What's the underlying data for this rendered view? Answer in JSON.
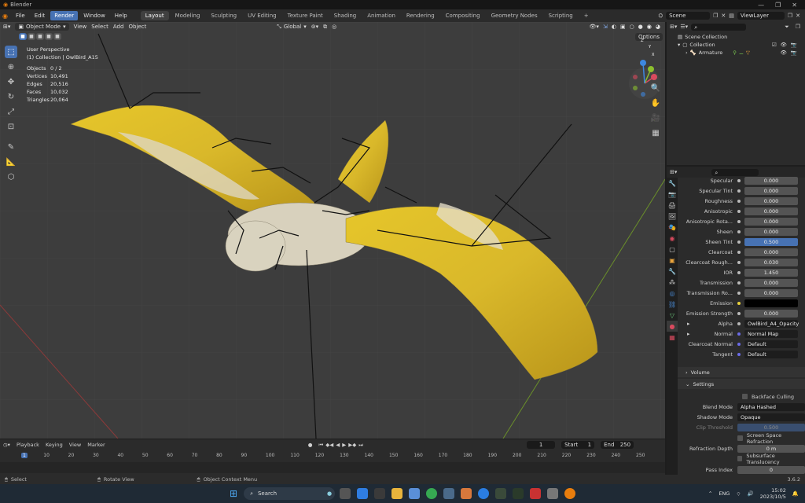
{
  "titlebar": {
    "title": "Blender"
  },
  "menus": [
    "File",
    "Edit",
    "Render",
    "Window",
    "Help"
  ],
  "workspaces": [
    "Layout",
    "Modeling",
    "Sculpting",
    "UV Editing",
    "Texture Paint",
    "Shading",
    "Animation",
    "Rendering",
    "Compositing",
    "Geometry Nodes",
    "Scripting"
  ],
  "scene": "Scene",
  "view_layer": "ViewLayer",
  "viewport_header": {
    "mode": "Object Mode",
    "items": [
      "View",
      "Select",
      "Add",
      "Object"
    ],
    "orientation": "Global",
    "options": "Options"
  },
  "overlay_text": {
    "perspective": "User Perspective",
    "collection": "(1) Collection | OwlBird_A15",
    "stats": [
      {
        "label": "Objects",
        "value": "0 / 2"
      },
      {
        "label": "Vertices",
        "value": "10,491"
      },
      {
        "label": "Edges",
        "value": "20,516"
      },
      {
        "label": "Faces",
        "value": "10,032"
      },
      {
        "label": "Triangles",
        "value": "20,064"
      }
    ]
  },
  "gizmo": {
    "x": "X",
    "y": "Y",
    "z": "Z"
  },
  "outliner": {
    "search_placeholder": "",
    "rows": [
      "Scene Collection",
      "Collection",
      "Armature"
    ]
  },
  "properties": {
    "rows": [
      {
        "label": "Specular",
        "value": "0.000"
      },
      {
        "label": "Specular Tint",
        "value": "0.000"
      },
      {
        "label": "Roughness",
        "value": "0.000"
      },
      {
        "label": "Anisotropic",
        "value": "0.000"
      },
      {
        "label": "Anisotropic Rota...",
        "value": "0.000"
      },
      {
        "label": "Sheen",
        "value": "0.000"
      },
      {
        "label": "Sheen Tint",
        "value": "0.500"
      },
      {
        "label": "Clearcoat",
        "value": "0.000"
      },
      {
        "label": "Clearcoat Rough...",
        "value": "0.030"
      },
      {
        "label": "IOR",
        "value": "1.450"
      },
      {
        "label": "Transmission",
        "value": "0.000"
      },
      {
        "label": "Transmission Ro...",
        "value": "0.000"
      },
      {
        "label": "Emission",
        "value": ""
      },
      {
        "label": "Emission Strength",
        "value": "0.000"
      },
      {
        "label": "Alpha",
        "value": "OwlBird_A4_Opacity"
      },
      {
        "label": "Normal",
        "value": "Normal Map"
      },
      {
        "label": "Clearcoat Normal",
        "value": "Default"
      },
      {
        "label": "Tangent",
        "value": "Default"
      }
    ],
    "panels": {
      "volume": "Volume",
      "settings": "Settings"
    },
    "settings": {
      "backface": "Backface Culling",
      "blend_label": "Blend Mode",
      "blend_value": "Alpha Hashed",
      "shadow_label": "Shadow Mode",
      "shadow_value": "Opaque",
      "clip_label": "Clip Threshold",
      "clip_value": "0.500",
      "ssr": "Screen Space Refraction",
      "refr_label": "Refraction Depth",
      "refr_value": "0 m",
      "sst": "Subsurface Translucency",
      "pass_label": "Pass Index",
      "pass_value": "0"
    }
  },
  "timeline": {
    "menus": [
      "Playback",
      "Keying",
      "View",
      "Marker"
    ],
    "current": "1",
    "start_label": "Start",
    "start": "1",
    "end_label": "End",
    "end": "250",
    "ticks": [
      "1",
      "10",
      "20",
      "30",
      "40",
      "50",
      "60",
      "70",
      "80",
      "90",
      "100",
      "110",
      "120",
      "130",
      "140",
      "150",
      "160",
      "170",
      "180",
      "190",
      "200",
      "210",
      "220",
      "230",
      "240",
      "250"
    ]
  },
  "statusbar": {
    "select": "Select",
    "rotate": "Rotate View",
    "context": "Object Context Menu",
    "version": "3.6.2"
  },
  "taskbar": {
    "search": "Search",
    "lang": "ENG",
    "time": "15:02",
    "date": "2023/10/5"
  }
}
